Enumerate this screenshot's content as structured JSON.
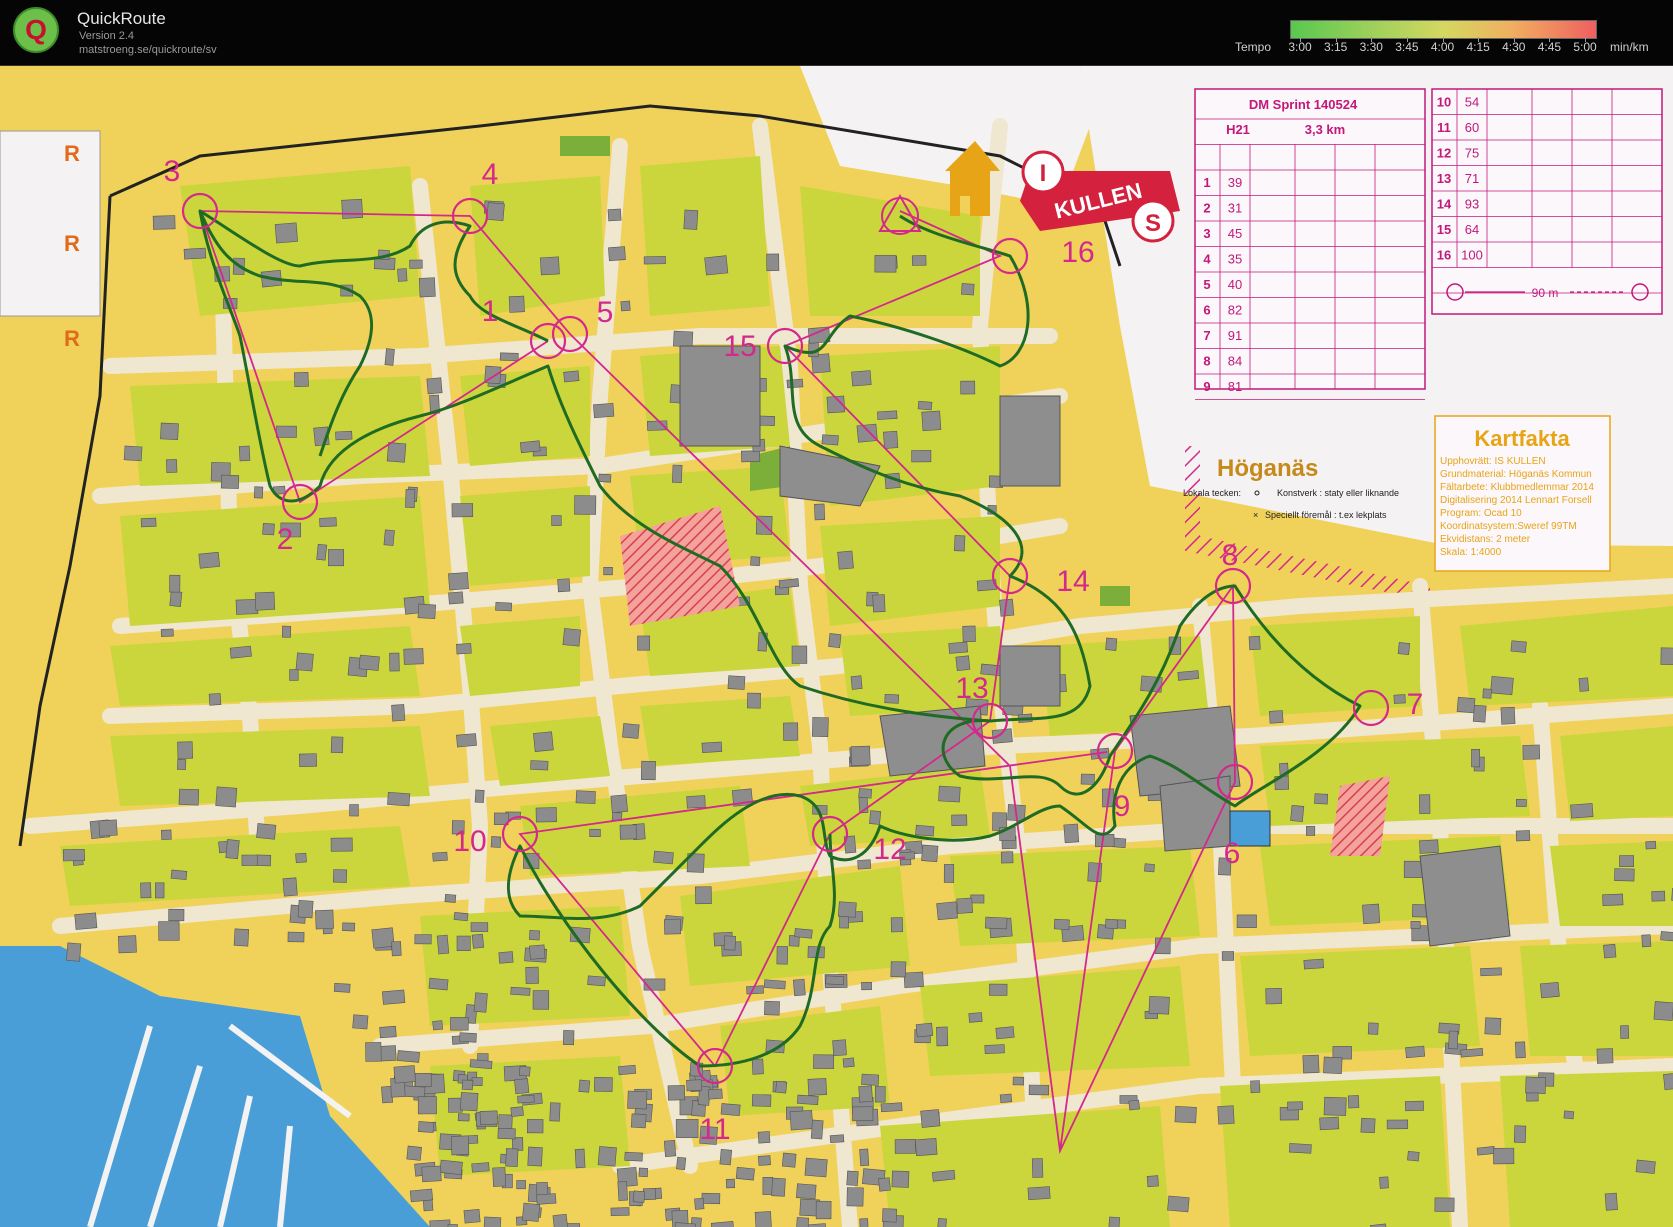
{
  "app": {
    "name": "QuickRoute",
    "version": "Version 2.4",
    "url": "matstroeng.se/quickroute/sv",
    "logo_letter": "Q"
  },
  "tempo": {
    "label": "Tempo",
    "unit": "min/km",
    "ticks": [
      "3:00",
      "3:15",
      "3:30",
      "3:45",
      "4:00",
      "4:15",
      "4:30",
      "4:45",
      "5:00"
    ]
  },
  "map": {
    "town": "Höganäs",
    "legend_title": "Lokala tecken:",
    "legend_1": "Konstverk : staty eller liknande",
    "legend_2": "Speciellt föremål : t.ex lekplats",
    "club_logo_text": "KULLEN",
    "club_logo_letters": [
      "I",
      "S"
    ],
    "oob_marks": [
      "R",
      "R",
      "R"
    ],
    "colors": {
      "route": "#1f6b23",
      "course": "#d4288c",
      "map_yellow": "#f0d25a",
      "open_green": "#cbd63c",
      "building": "#8c8c8c",
      "water": "#4a9ed8",
      "road": "#efe7cf"
    },
    "control_numbers": [
      "1",
      "2",
      "3",
      "4",
      "5",
      "6",
      "7",
      "8",
      "9",
      "10",
      "11",
      "12",
      "13",
      "14",
      "15",
      "16"
    ],
    "description_sheet": {
      "title": "DM Sprint 140524",
      "class": "H21",
      "length": "3,3 km",
      "rows_left": [
        {
          "n": "1",
          "code": "39"
        },
        {
          "n": "2",
          "code": "31"
        },
        {
          "n": "3",
          "code": "45"
        },
        {
          "n": "4",
          "code": "35"
        },
        {
          "n": "5",
          "code": "40"
        },
        {
          "n": "6",
          "code": "82"
        },
        {
          "n": "7",
          "code": "91"
        },
        {
          "n": "8",
          "code": "84"
        },
        {
          "n": "9",
          "code": "81"
        }
      ],
      "rows_right": [
        {
          "n": "10",
          "code": "54"
        },
        {
          "n": "11",
          "code": "60"
        },
        {
          "n": "12",
          "code": "75"
        },
        {
          "n": "13",
          "code": "71"
        },
        {
          "n": "14",
          "code": "93"
        },
        {
          "n": "15",
          "code": "64"
        },
        {
          "n": "16",
          "code": "100"
        }
      ],
      "finish": "90 m"
    },
    "kartfakta": {
      "title": "Kartfakta",
      "lines": [
        "Upphovrätt: IS KULLEN",
        "Grundmaterial: Höganäs Kommun",
        "Fältarbete: Klubbmedlemmar  2014",
        "Digitalisering  2014 Lennart Forsell",
        "Program: Ocad 10",
        "Koordinatsystem:Sweref  99TM",
        "Ekvidistans: 2 meter",
        "Skala: 1:4000"
      ]
    }
  }
}
